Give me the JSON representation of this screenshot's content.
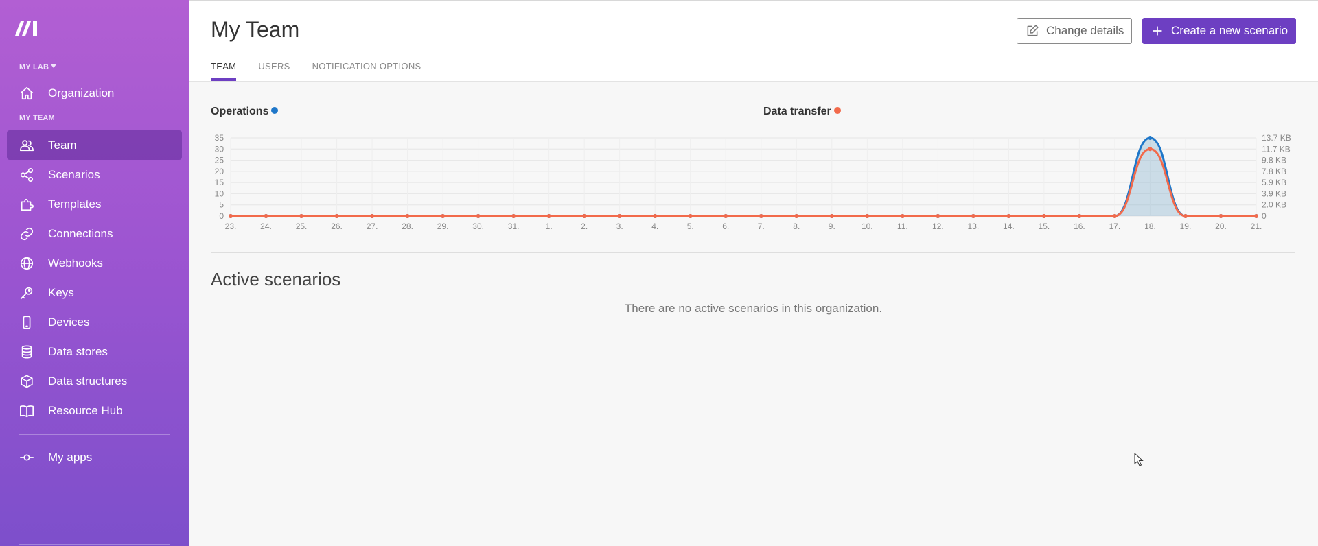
{
  "sidebar": {
    "org_section": "MY LAB",
    "team_section": "MY TEAM",
    "org_item": {
      "label": "Organization",
      "icon": "home-icon"
    },
    "items": [
      {
        "label": "Team",
        "icon": "users-icon",
        "active": true
      },
      {
        "label": "Scenarios",
        "icon": "share-icon"
      },
      {
        "label": "Templates",
        "icon": "puzzle-icon"
      },
      {
        "label": "Connections",
        "icon": "link-icon"
      },
      {
        "label": "Webhooks",
        "icon": "globe-icon"
      },
      {
        "label": "Keys",
        "icon": "key-icon"
      },
      {
        "label": "Devices",
        "icon": "mobile-icon"
      },
      {
        "label": "Data stores",
        "icon": "database-icon"
      },
      {
        "label": "Data structures",
        "icon": "cube-icon"
      },
      {
        "label": "Resource Hub",
        "icon": "book-icon"
      }
    ],
    "apps_item": {
      "label": "My apps",
      "icon": "commit-icon"
    }
  },
  "header": {
    "title": "My Team",
    "tabs": [
      {
        "label": "TEAM",
        "active": true
      },
      {
        "label": "USERS"
      },
      {
        "label": "NOTIFICATION OPTIONS"
      }
    ],
    "change_details_label": "Change details",
    "create_scenario_label": "Create a new scenario"
  },
  "chart_data": {
    "type": "area",
    "categories": [
      "23.",
      "24.",
      "25.",
      "26.",
      "27.",
      "28.",
      "29.",
      "30.",
      "31.",
      "1.",
      "2.",
      "3.",
      "4.",
      "5.",
      "6.",
      "7.",
      "8.",
      "9.",
      "10.",
      "11.",
      "12.",
      "13.",
      "14.",
      "15.",
      "16.",
      "17.",
      "18.",
      "19.",
      "20.",
      "21."
    ],
    "series": [
      {
        "name": "Operations",
        "color": "#1f77c9",
        "axis": "left",
        "values": [
          0,
          0,
          0,
          0,
          0,
          0,
          0,
          0,
          0,
          0,
          0,
          0,
          0,
          0,
          0,
          0,
          0,
          0,
          0,
          0,
          0,
          0,
          0,
          0,
          0,
          0,
          35,
          0,
          0,
          0
        ]
      },
      {
        "name": "Data transfer",
        "color": "#f26a4b",
        "axis": "right",
        "values": [
          0,
          0,
          0,
          0,
          0,
          0,
          0,
          0,
          0,
          0,
          0,
          0,
          0,
          0,
          0,
          0,
          0,
          0,
          0,
          0,
          0,
          0,
          0,
          0,
          0,
          0,
          30,
          0,
          0,
          0
        ]
      }
    ],
    "y_left_ticks": [
      "0",
      "5",
      "10",
      "15",
      "20",
      "25",
      "30",
      "35"
    ],
    "y_right_ticks": [
      "0",
      "2.0 KB",
      "3.9 KB",
      "5.9 KB",
      "7.8 KB",
      "9.8 KB",
      "11.7 KB",
      "13.7 KB"
    ],
    "ylim": [
      0,
      35
    ],
    "grid": true
  },
  "active_scenarios": {
    "title": "Active scenarios",
    "empty_message": "There are no active scenarios in this organization."
  }
}
